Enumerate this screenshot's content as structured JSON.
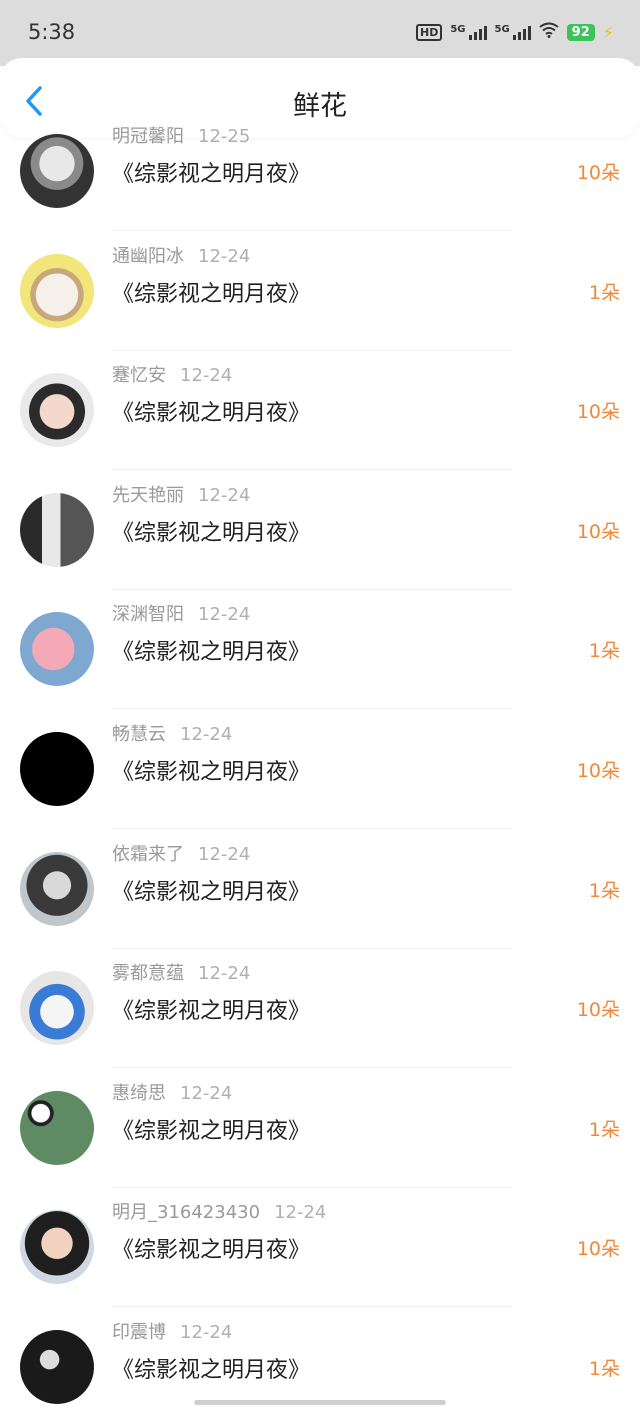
{
  "status_bar": {
    "time": "5:38",
    "hd_label": "HD",
    "signal_1": "5G",
    "signal_2": "5G",
    "battery": "92"
  },
  "header": {
    "title": "鲜花",
    "back_icon": "chevron-left-icon"
  },
  "colors": {
    "accent_orange": "#f0883a",
    "back_blue": "#2196f3",
    "meta_gray": "#9a9a9a"
  },
  "records": [
    {
      "user": "明冠馨阳",
      "date": "12-25",
      "book": "《综影视之明月夜》",
      "count": "10朵",
      "avatar": "anime-avatar"
    },
    {
      "user": "通幽阳冰",
      "date": "12-24",
      "book": "《综影视之明月夜》",
      "count": "1朵",
      "avatar": "cat-avatar"
    },
    {
      "user": "蹇忆安",
      "date": "12-24",
      "book": "《综影视之明月夜》",
      "count": "10朵",
      "avatar": "girl-avatar"
    },
    {
      "user": "先天艳丽",
      "date": "12-24",
      "book": "《综影视之明月夜》",
      "count": "10朵",
      "avatar": "couple-avatar"
    },
    {
      "user": "深渊智阳",
      "date": "12-24",
      "book": "《综影视之明月夜》",
      "count": "1朵",
      "avatar": "cartoon-avatar"
    },
    {
      "user": "畅慧云",
      "date": "12-24",
      "book": "《综影视之明月夜》",
      "count": "10朵",
      "avatar": "black-avatar"
    },
    {
      "user": "依霜来了",
      "date": "12-24",
      "book": "《综影视之明月夜》",
      "count": "1朵",
      "avatar": "anime-girl-avatar"
    },
    {
      "user": "雾都意蕴",
      "date": "12-24",
      "book": "《综影视之明月夜》",
      "count": "10朵",
      "avatar": "cat-hat-avatar"
    },
    {
      "user": "惠绮思",
      "date": "12-24",
      "book": "《综影视之明月夜》",
      "count": "1朵",
      "avatar": "panda-avatar"
    },
    {
      "user": "明月_316423430",
      "date": "12-24",
      "book": "《综影视之明月夜》",
      "count": "10朵",
      "avatar": "woman-avatar"
    },
    {
      "user": "印震博",
      "date": "12-24",
      "book": "《综影视之明月夜》",
      "count": "1朵",
      "avatar": "bw-avatar"
    }
  ]
}
